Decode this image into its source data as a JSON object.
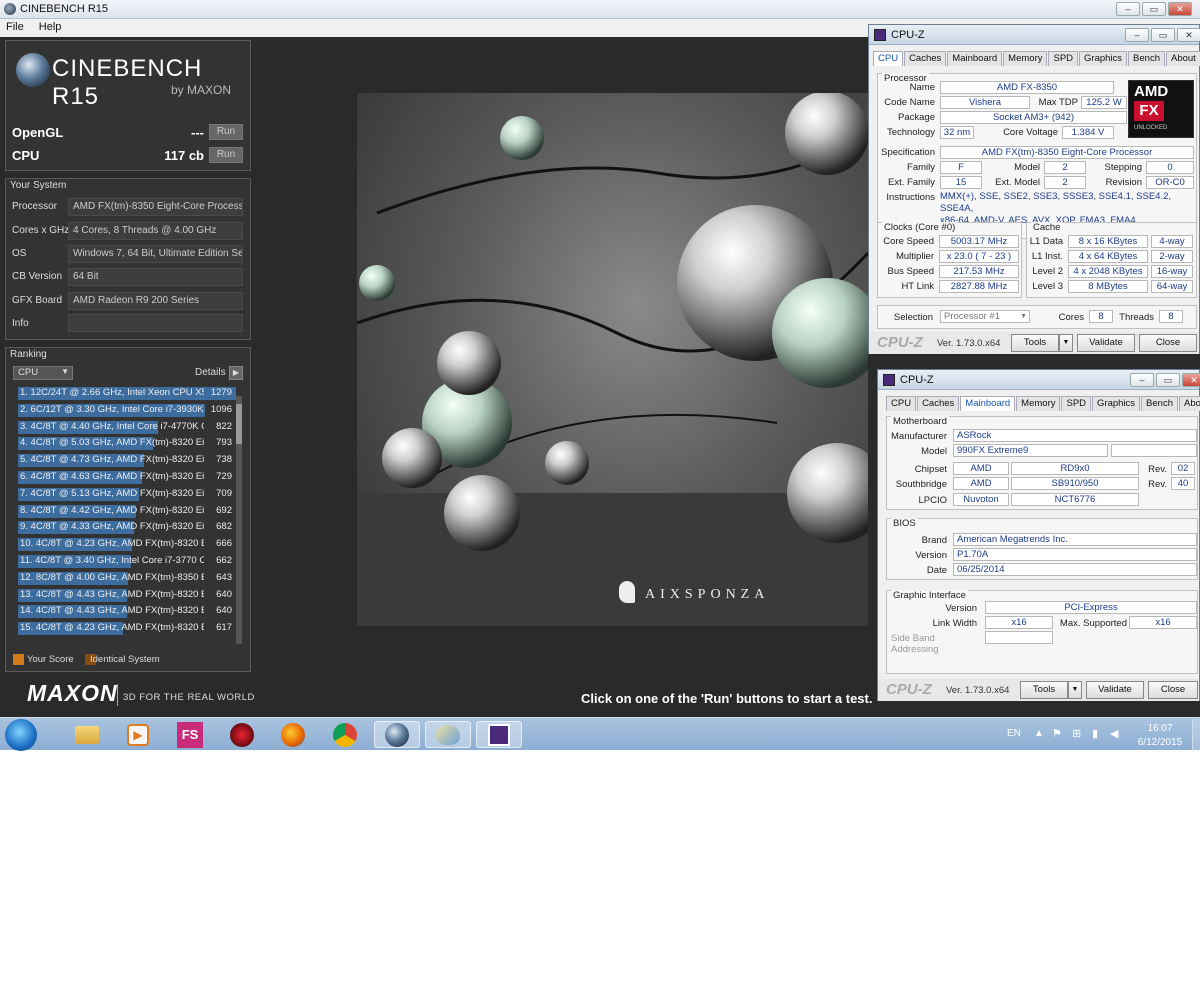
{
  "cinebench": {
    "title": "CINEBENCH R15",
    "menu": [
      "File",
      "Help"
    ],
    "logo_main": "CINEBENCH R15",
    "logo_sub": "by MAXON",
    "opengl_label": "OpenGL",
    "opengl_value": "---",
    "cpu_label": "CPU",
    "cpu_value": "117 cb",
    "run_label": "Run",
    "system_title": "Your System",
    "system": [
      {
        "label": "Processor",
        "value": "AMD FX(tm)-8350 Eight-Core Processor"
      },
      {
        "label": "Cores x GHz",
        "value": "4 Cores, 8 Threads @ 4.00 GHz"
      },
      {
        "label": "OS",
        "value": "Windows 7, 64 Bit, Ultimate Edition Ser"
      },
      {
        "label": "CB Version",
        "value": "64 Bit"
      },
      {
        "label": "GFX Board",
        "value": "AMD Radeon R9 200 Series"
      },
      {
        "label": "Info",
        "value": ""
      }
    ],
    "ranking_title": "Ranking",
    "ranking_dropdown": "CPU",
    "details_label": "Details",
    "ranking_max": 1279,
    "ranking": [
      {
        "text": "1. 12C/24T @ 2.66 GHz, Intel Xeon CPU X56",
        "score": 1279
      },
      {
        "text": "2. 6C/12T @ 3.30 GHz,  Intel Core i7-3930K",
        "score": 1096
      },
      {
        "text": "3. 4C/8T @ 4.40 GHz, Intel Core i7-4770K CP",
        "score": 822
      },
      {
        "text": "4. 4C/8T @ 5.03 GHz, AMD FX(tm)-8320 Eigh",
        "score": 793
      },
      {
        "text": "5. 4C/8T @ 4.73 GHz, AMD FX(tm)-8320 Eigh",
        "score": 738
      },
      {
        "text": "6. 4C/8T @ 4.63 GHz, AMD FX(tm)-8320 Eigh",
        "score": 729
      },
      {
        "text": "7. 4C/8T @ 5.13 GHz, AMD FX(tm)-8320 Eigh",
        "score": 709
      },
      {
        "text": "8. 4C/8T @ 4.42 GHz, AMD FX(tm)-8320 Eigh",
        "score": 692
      },
      {
        "text": "9. 4C/8T @ 4.33 GHz, AMD FX(tm)-8320 Eigh",
        "score": 682
      },
      {
        "text": "10. 4C/8T @ 4.23 GHz, AMD FX(tm)-8320 Eig",
        "score": 666
      },
      {
        "text": "11. 4C/8T @ 3.40 GHz,  Intel Core i7-3770 CF",
        "score": 662
      },
      {
        "text": "12. 8C/8T @ 4.00 GHz, AMD FX(tm)-8350 Eig",
        "score": 643
      },
      {
        "text": "13. 4C/8T @ 4.43 GHz, AMD FX(tm)-8320 Eig",
        "score": 640
      },
      {
        "text": "14. 4C/8T @ 4.43 GHz, AMD FX(tm)-8320 Eig",
        "score": 640
      },
      {
        "text": "15. 4C/8T @ 4.23 GHz, AMD FX(tm)-8320 Eig",
        "score": 617
      }
    ],
    "legend_your": "Your Score",
    "legend_identical": "Identical System",
    "maxon_logo": "MAXON",
    "maxon_tagline": "3D FOR THE REAL WORLD",
    "render_watermark": "AIXSPONZA",
    "status": "Click on one of the 'Run' buttons to start a test."
  },
  "cpuz_cpu": {
    "title": "CPU-Z",
    "tabs": [
      "CPU",
      "Caches",
      "Mainboard",
      "Memory",
      "SPD",
      "Graphics",
      "Bench",
      "About"
    ],
    "processor_group": "Processor",
    "name_label": "Name",
    "name": "AMD FX-8350",
    "codename_label": "Code Name",
    "codename": "Vishera",
    "maxtdp_label": "Max TDP",
    "maxtdp": "125.2 W",
    "package_label": "Package",
    "package": "Socket AM3+ (942)",
    "technology_label": "Technology",
    "technology": "32 nm",
    "corevoltage_label": "Core Voltage",
    "corevoltage": "1.384 V",
    "specification_label": "Specification",
    "specification": "AMD FX(tm)-8350 Eight-Core Processor",
    "family_label": "Family",
    "family": "F",
    "model_label": "Model",
    "model": "2",
    "stepping_label": "Stepping",
    "stepping": "0",
    "extfamily_label": "Ext. Family",
    "extfamily": "15",
    "extmodel_label": "Ext. Model",
    "extmodel": "2",
    "revision_label": "Revision",
    "revision": "OR-C0",
    "instructions_label": "Instructions",
    "instructions_1": "MMX(+), SSE, SSE2, SSE3, SSSE3, SSE4.1, SSE4.2, SSE4A,",
    "instructions_2": "x86-64, AMD-V, AES, AVX, XOP, FMA3, FMA4",
    "amd_logo_top": "AMD",
    "amd_logo_fx": "FX",
    "amd_logo_sub": "UNLOCKED",
    "clocks_group": "Clocks (Core #0)",
    "corespeed_label": "Core Speed",
    "corespeed": "5003.17 MHz",
    "multiplier_label": "Multiplier",
    "multiplier": "x 23.0 ( 7 - 23 )",
    "busspeed_label": "Bus Speed",
    "busspeed": "217.53 MHz",
    "htlink_label": "HT Link",
    "htlink": "2827.88 MHz",
    "cache_group": "Cache",
    "l1data_label": "L1 Data",
    "l1data": "8 x 16 KBytes",
    "l1data_way": "4-way",
    "l1inst_label": "L1 Inst.",
    "l1inst": "4 x 64 KBytes",
    "l1inst_way": "2-way",
    "l2_label": "Level 2",
    "l2": "4 x 2048 KBytes",
    "l2_way": "16-way",
    "l3_label": "Level 3",
    "l3": "8 MBytes",
    "l3_way": "64-way",
    "selection_label": "Selection",
    "selection": "Processor #1",
    "cores_label": "Cores",
    "cores": "8",
    "threads_label": "Threads",
    "threads": "8",
    "brand": "CPU-Z",
    "version": "Ver. 1.73.0.x64",
    "tools": "Tools",
    "validate": "Validate",
    "close": "Close"
  },
  "cpuz_mb": {
    "title": "CPU-Z",
    "tabs": [
      "CPU",
      "Caches",
      "Mainboard",
      "Memory",
      "SPD",
      "Graphics",
      "Bench",
      "About"
    ],
    "motherboard_group": "Motherboard",
    "manufacturer_label": "Manufacturer",
    "manufacturer": "ASRock",
    "model_label": "Model",
    "model": "990FX Extreme9",
    "chipset_label": "Chipset",
    "chipset_vendor": "AMD",
    "chipset": "RD9x0",
    "chipset_rev_label": "Rev.",
    "chipset_rev": "02",
    "southbridge_label": "Southbridge",
    "sb_vendor": "AMD",
    "sb": "SB910/950",
    "sb_rev_label": "Rev.",
    "sb_rev": "40",
    "lpcio_label": "LPCIO",
    "lpcio_vendor": "Nuvoton",
    "lpcio": "NCT6776",
    "bios_group": "BIOS",
    "brand_label": "Brand",
    "bios_brand": "American Megatrends Inc.",
    "version_label": "Version",
    "bios_version": "P1.70A",
    "date_label": "Date",
    "bios_date": "06/25/2014",
    "gi_group": "Graphic Interface",
    "gi_version_label": "Version",
    "gi_version": "PCI-Express",
    "linkwidth_label": "Link Width",
    "linkwidth": "x16",
    "maxsupported_label": "Max. Supported",
    "maxsupported": "x16",
    "sideband_label": "Side Band Addressing",
    "brand": "CPU-Z",
    "version": "Ver. 1.73.0.x64",
    "tools": "Tools",
    "validate": "Validate",
    "close": "Close"
  },
  "taskbar": {
    "lang": "EN",
    "time": "16:07",
    "date": "6/12/2015",
    "fs_label": "FS"
  }
}
